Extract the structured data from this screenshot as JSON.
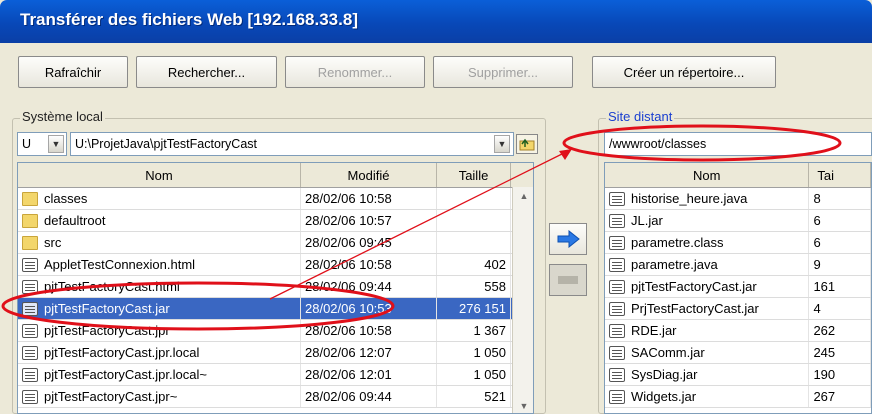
{
  "window": {
    "title": "Transférer des fichiers Web [192.168.33.8]"
  },
  "toolbar": {
    "refresh": "Rafraîchir",
    "search": "Rechercher...",
    "rename": "Renommer...",
    "delete": "Supprimer...",
    "mkdir": "Créer un répertoire..."
  },
  "local": {
    "group_label": "Système local",
    "drive": "U",
    "path": "U:\\ProjetJava\\pjtTestFactoryCast",
    "columns": [
      "Nom",
      "Modifié",
      "Taille"
    ],
    "rows": [
      {
        "icon": "folder",
        "name": "classes",
        "modified": "28/02/06 10:58",
        "size": ""
      },
      {
        "icon": "folder",
        "name": "defaultroot",
        "modified": "28/02/06 10:57",
        "size": ""
      },
      {
        "icon": "folder",
        "name": "src",
        "modified": "28/02/06 09:45",
        "size": ""
      },
      {
        "icon": "file",
        "name": "AppletTestConnexion.html",
        "modified": "28/02/06 10:58",
        "size": "402"
      },
      {
        "icon": "file",
        "name": "pjtTestFactoryCast.html",
        "modified": "28/02/06 09:44",
        "size": "558"
      },
      {
        "icon": "file",
        "name": "pjtTestFactoryCast.jar",
        "modified": "28/02/06 10:53",
        "size": "276 151",
        "selected": true
      },
      {
        "icon": "file",
        "name": "pjtTestFactoryCast.jpr",
        "modified": "28/02/06 10:58",
        "size": "1 367"
      },
      {
        "icon": "file",
        "name": "pjtTestFactoryCast.jpr.local",
        "modified": "28/02/06 12:07",
        "size": "1 050"
      },
      {
        "icon": "file",
        "name": "pjtTestFactoryCast.jpr.local~",
        "modified": "28/02/06 12:01",
        "size": "1 050"
      },
      {
        "icon": "file",
        "name": "pjtTestFactoryCast.jpr~",
        "modified": "28/02/06 09:44",
        "size": "521"
      }
    ]
  },
  "remote": {
    "group_label": "Site distant",
    "path": "/wwwroot/classes",
    "columns": [
      "Nom",
      "Tai"
    ],
    "rows": [
      {
        "name": "historise_heure.java",
        "size": "8"
      },
      {
        "name": "JL.jar",
        "size": "6"
      },
      {
        "name": "parametre.class",
        "size": "6"
      },
      {
        "name": "parametre.java",
        "size": "9"
      },
      {
        "name": "pjtTestFactoryCast.jar",
        "size": "161"
      },
      {
        "name": "PrjTestFactoryCast.jar",
        "size": "4"
      },
      {
        "name": "RDE.jar",
        "size": "262"
      },
      {
        "name": "SAComm.jar",
        "size": "245"
      },
      {
        "name": "SysDiag.jar",
        "size": "190"
      },
      {
        "name": "Widgets.jar",
        "size": "267"
      }
    ]
  },
  "colors": {
    "title_bar": "#0848b8",
    "selection": "#3a67c2",
    "annotation": "#e0101a",
    "transfer_arrow": "#2a78e4"
  }
}
